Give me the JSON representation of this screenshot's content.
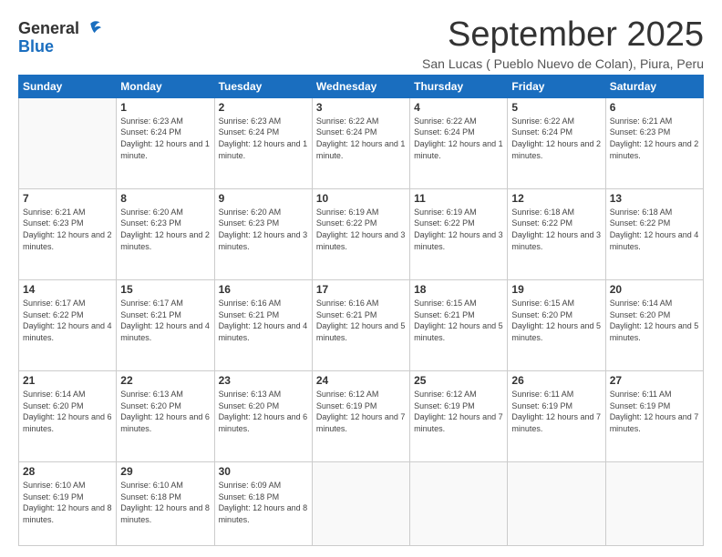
{
  "logo": {
    "general": "General",
    "blue": "Blue"
  },
  "title": "September 2025",
  "subtitle": "San Lucas ( Pueblo Nuevo de Colan), Piura, Peru",
  "days_of_week": [
    "Sunday",
    "Monday",
    "Tuesday",
    "Wednesday",
    "Thursday",
    "Friday",
    "Saturday"
  ],
  "weeks": [
    [
      {
        "day": "",
        "info": ""
      },
      {
        "day": "1",
        "info": "Sunrise: 6:23 AM\nSunset: 6:24 PM\nDaylight: 12 hours and 1 minute."
      },
      {
        "day": "2",
        "info": "Sunrise: 6:23 AM\nSunset: 6:24 PM\nDaylight: 12 hours and 1 minute."
      },
      {
        "day": "3",
        "info": "Sunrise: 6:22 AM\nSunset: 6:24 PM\nDaylight: 12 hours and 1 minute."
      },
      {
        "day": "4",
        "info": "Sunrise: 6:22 AM\nSunset: 6:24 PM\nDaylight: 12 hours and 1 minute."
      },
      {
        "day": "5",
        "info": "Sunrise: 6:22 AM\nSunset: 6:24 PM\nDaylight: 12 hours and 2 minutes."
      },
      {
        "day": "6",
        "info": "Sunrise: 6:21 AM\nSunset: 6:23 PM\nDaylight: 12 hours and 2 minutes."
      }
    ],
    [
      {
        "day": "7",
        "info": "Sunrise: 6:21 AM\nSunset: 6:23 PM\nDaylight: 12 hours and 2 minutes."
      },
      {
        "day": "8",
        "info": "Sunrise: 6:20 AM\nSunset: 6:23 PM\nDaylight: 12 hours and 2 minutes."
      },
      {
        "day": "9",
        "info": "Sunrise: 6:20 AM\nSunset: 6:23 PM\nDaylight: 12 hours and 3 minutes."
      },
      {
        "day": "10",
        "info": "Sunrise: 6:19 AM\nSunset: 6:22 PM\nDaylight: 12 hours and 3 minutes."
      },
      {
        "day": "11",
        "info": "Sunrise: 6:19 AM\nSunset: 6:22 PM\nDaylight: 12 hours and 3 minutes."
      },
      {
        "day": "12",
        "info": "Sunrise: 6:18 AM\nSunset: 6:22 PM\nDaylight: 12 hours and 3 minutes."
      },
      {
        "day": "13",
        "info": "Sunrise: 6:18 AM\nSunset: 6:22 PM\nDaylight: 12 hours and 4 minutes."
      }
    ],
    [
      {
        "day": "14",
        "info": "Sunrise: 6:17 AM\nSunset: 6:22 PM\nDaylight: 12 hours and 4 minutes."
      },
      {
        "day": "15",
        "info": "Sunrise: 6:17 AM\nSunset: 6:21 PM\nDaylight: 12 hours and 4 minutes."
      },
      {
        "day": "16",
        "info": "Sunrise: 6:16 AM\nSunset: 6:21 PM\nDaylight: 12 hours and 4 minutes."
      },
      {
        "day": "17",
        "info": "Sunrise: 6:16 AM\nSunset: 6:21 PM\nDaylight: 12 hours and 5 minutes."
      },
      {
        "day": "18",
        "info": "Sunrise: 6:15 AM\nSunset: 6:21 PM\nDaylight: 12 hours and 5 minutes."
      },
      {
        "day": "19",
        "info": "Sunrise: 6:15 AM\nSunset: 6:20 PM\nDaylight: 12 hours and 5 minutes."
      },
      {
        "day": "20",
        "info": "Sunrise: 6:14 AM\nSunset: 6:20 PM\nDaylight: 12 hours and 5 minutes."
      }
    ],
    [
      {
        "day": "21",
        "info": "Sunrise: 6:14 AM\nSunset: 6:20 PM\nDaylight: 12 hours and 6 minutes."
      },
      {
        "day": "22",
        "info": "Sunrise: 6:13 AM\nSunset: 6:20 PM\nDaylight: 12 hours and 6 minutes."
      },
      {
        "day": "23",
        "info": "Sunrise: 6:13 AM\nSunset: 6:20 PM\nDaylight: 12 hours and 6 minutes."
      },
      {
        "day": "24",
        "info": "Sunrise: 6:12 AM\nSunset: 6:19 PM\nDaylight: 12 hours and 7 minutes."
      },
      {
        "day": "25",
        "info": "Sunrise: 6:12 AM\nSunset: 6:19 PM\nDaylight: 12 hours and 7 minutes."
      },
      {
        "day": "26",
        "info": "Sunrise: 6:11 AM\nSunset: 6:19 PM\nDaylight: 12 hours and 7 minutes."
      },
      {
        "day": "27",
        "info": "Sunrise: 6:11 AM\nSunset: 6:19 PM\nDaylight: 12 hours and 7 minutes."
      }
    ],
    [
      {
        "day": "28",
        "info": "Sunrise: 6:10 AM\nSunset: 6:19 PM\nDaylight: 12 hours and 8 minutes."
      },
      {
        "day": "29",
        "info": "Sunrise: 6:10 AM\nSunset: 6:18 PM\nDaylight: 12 hours and 8 minutes."
      },
      {
        "day": "30",
        "info": "Sunrise: 6:09 AM\nSunset: 6:18 PM\nDaylight: 12 hours and 8 minutes."
      },
      {
        "day": "",
        "info": ""
      },
      {
        "day": "",
        "info": ""
      },
      {
        "day": "",
        "info": ""
      },
      {
        "day": "",
        "info": ""
      }
    ]
  ]
}
